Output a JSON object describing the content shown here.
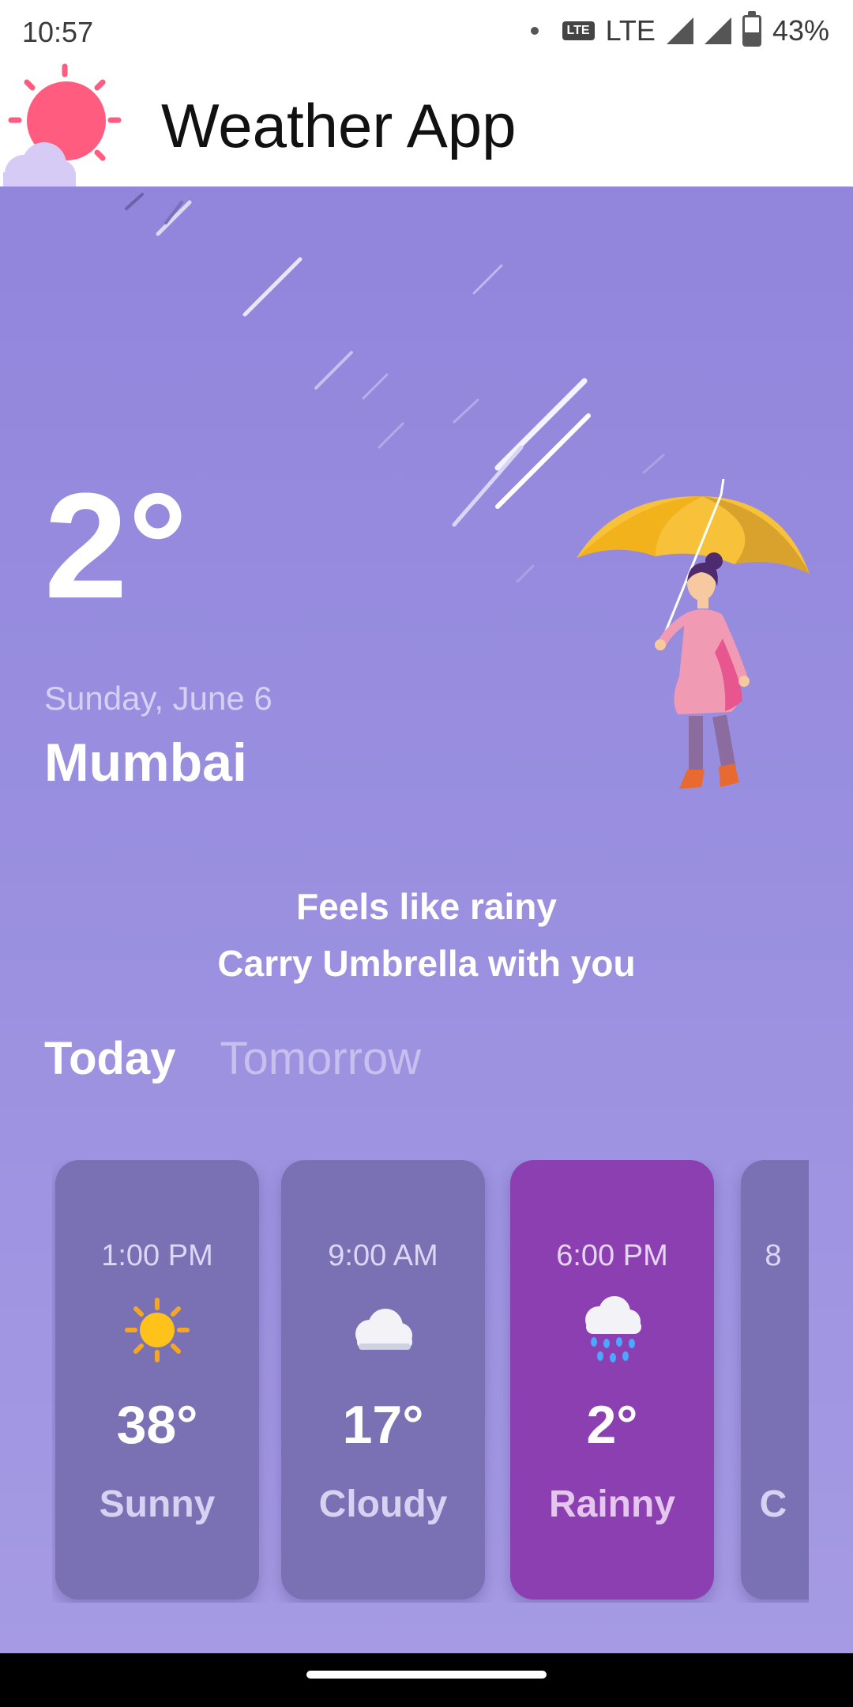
{
  "status_bar": {
    "time": "10:57",
    "volte": "LTE",
    "network": "LTE",
    "battery": "43%"
  },
  "app_bar": {
    "title": "Weather App",
    "logo_icon": "sun-cloud-icon"
  },
  "current": {
    "temperature": "2°",
    "date": "Sunday, June 6",
    "city": "Mumbai"
  },
  "message": {
    "line1": "Feels like rainy",
    "line2": "Carry Umbrella with you"
  },
  "tabs": [
    {
      "label": "Today",
      "active": true
    },
    {
      "label": "Tomorrow",
      "active": false
    }
  ],
  "forecast": [
    {
      "time": "1:00 PM",
      "icon": "sun-icon",
      "temp": "38°",
      "condition": "Sunny",
      "active": false
    },
    {
      "time": "9:00 AM",
      "icon": "cloud-icon",
      "temp": "17°",
      "condition": "Cloudy",
      "active": false
    },
    {
      "time": "6:00 PM",
      "icon": "rain-cloud-icon",
      "temp": "2°",
      "condition": "Rainny",
      "active": true
    },
    {
      "time": "8",
      "icon": "",
      "temp": "",
      "condition": "C",
      "active": false
    }
  ],
  "colors": {
    "background": "#9185dc",
    "card": "#7a70b4",
    "card_active": "#8c3fb1",
    "sun": "#ff5c7f",
    "umbrella": "#f7c23a",
    "dress": "#f19ab4"
  }
}
